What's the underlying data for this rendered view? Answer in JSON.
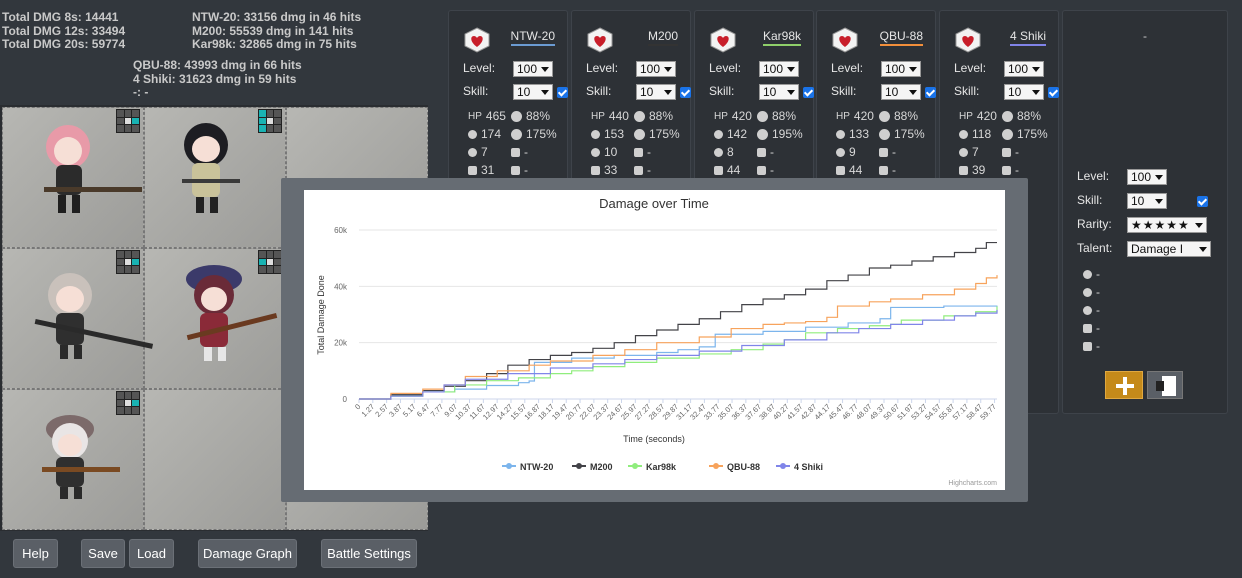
{
  "totals": [
    "Total DMG 8s: 14441",
    "Total DMG 12s: 33494",
    "Total DMG 20s: 59774"
  ],
  "dmg_lines_right": [
    "NTW-20: 33156 dmg in 46 hits",
    "M200: 55539 dmg in 141 hits",
    "Kar98k: 32865 dmg in 75 hits"
  ],
  "dmg_lines_lower": [
    "QBU-88: 43993 dmg in 66 hits",
    "4 Shiki: 31623 dmg in 59 hits",
    "-: -"
  ],
  "buttons": {
    "help": "Help",
    "save": "Save",
    "load": "Load",
    "graph": "Damage Graph",
    "battle": "Battle Settings"
  },
  "labels": {
    "level": "Level:",
    "skill": "Skill:",
    "rarity": "Rarity:",
    "talent": "Talent:"
  },
  "dolls": [
    {
      "name": "NTW-20",
      "color": "#6b9bd2",
      "level": "100",
      "skill": "10",
      "hp": "465",
      "acc": "88%",
      "fp": "174",
      "crit": "175%",
      "ev": "7",
      "ammo": "-",
      "armor": "31",
      "extra": "-"
    },
    {
      "name": "M200",
      "color": "#333333",
      "level": "100",
      "skill": "10",
      "hp": "440",
      "acc": "88%",
      "fp": "153",
      "crit": "175%",
      "ev": "10",
      "ammo": "-",
      "armor": "33",
      "extra": "-"
    },
    {
      "name": "Kar98k",
      "color": "#8fcf6a",
      "level": "100",
      "skill": "10",
      "hp": "420",
      "acc": "88%",
      "fp": "142",
      "crit": "195%",
      "ev": "8",
      "ammo": "-",
      "armor": "44",
      "extra": "-"
    },
    {
      "name": "QBU-88",
      "color": "#f28f3b",
      "level": "100",
      "skill": "10",
      "hp": "420",
      "acc": "88%",
      "fp": "133",
      "crit": "175%",
      "ev": "9",
      "ammo": "-",
      "armor": "44",
      "extra": "-"
    },
    {
      "name": "4 Shiki",
      "color": "#8083e8",
      "level": "100",
      "skill": "10",
      "hp": "420",
      "acc": "88%",
      "fp": "118",
      "crit": "175%",
      "ev": "7",
      "ammo": "-",
      "armor": "39",
      "extra": "-"
    }
  ],
  "empty_panel": {
    "title": "-",
    "level": "100",
    "skill": "10",
    "rarity": "★★★★★",
    "talent": "Damage I",
    "stats": [
      "-",
      "-",
      "-",
      "-",
      "-"
    ]
  },
  "colors": {
    "accent": "#c58a1a",
    "heart": "#c81e2a",
    "background": "#32373d",
    "teal": "#19b3b3"
  },
  "chart_data": {
    "type": "line",
    "title": "Damage over Time",
    "xlabel": "Time (seconds)",
    "ylabel": "Total Damage Done",
    "ylim": [
      0,
      60000
    ],
    "yticks": [
      "0",
      "20k",
      "40k",
      "60k"
    ],
    "xticks": [
      "0",
      "1.27",
      "2.57",
      "3.87",
      "5.17",
      "6.47",
      "7.77",
      "9.07",
      "10.37",
      "11.67",
      "12.97",
      "14.27",
      "15.57",
      "16.87",
      "18.17",
      "19.47",
      "20.77",
      "22.07",
      "23.37",
      "24.67",
      "25.97",
      "27.27",
      "28.57",
      "29.87",
      "31.17",
      "32.47",
      "33.77",
      "35.07",
      "36.37",
      "37.67",
      "38.97",
      "40.27",
      "41.57",
      "42.87",
      "44.17",
      "45.47",
      "46.77",
      "48.07",
      "49.37",
      "50.67",
      "51.97",
      "53.27",
      "54.57",
      "55.87",
      "57.17",
      "58.47",
      "59.77"
    ],
    "legend_position": "bottom",
    "credit": "Highcharts.com",
    "series": [
      {
        "name": "NTW-20",
        "color": "#7cb5ec",
        "points": [
          [
            0,
            0
          ],
          [
            3,
            1500
          ],
          [
            6,
            2500
          ],
          [
            9,
            3500
          ],
          [
            12,
            4800
          ],
          [
            15,
            5800
          ],
          [
            16,
            6400
          ],
          [
            16.5,
            13000
          ],
          [
            20,
            14500
          ],
          [
            24,
            15500
          ],
          [
            28,
            16500
          ],
          [
            30,
            17500
          ],
          [
            32,
            18500
          ],
          [
            33.5,
            23000
          ],
          [
            38,
            24000
          ],
          [
            42,
            25500
          ],
          [
            46,
            27000
          ],
          [
            49,
            28500
          ],
          [
            50,
            32500
          ],
          [
            55,
            33000
          ],
          [
            60,
            33156
          ]
        ]
      },
      {
        "name": "M200",
        "color": "#434348",
        "points": [
          [
            0,
            0
          ],
          [
            3,
            1500
          ],
          [
            6,
            3000
          ],
          [
            8,
            4500
          ],
          [
            10,
            6500
          ],
          [
            12,
            9000
          ],
          [
            14,
            12000
          ],
          [
            16,
            14000
          ],
          [
            18,
            15500
          ],
          [
            20,
            16500
          ],
          [
            22,
            18000
          ],
          [
            24,
            20000
          ],
          [
            26,
            22500
          ],
          [
            28,
            24500
          ],
          [
            30,
            26500
          ],
          [
            32,
            28500
          ],
          [
            34,
            31000
          ],
          [
            36,
            33500
          ],
          [
            38,
            35500
          ],
          [
            40,
            37000
          ],
          [
            42,
            39000
          ],
          [
            44,
            42000
          ],
          [
            46,
            44000
          ],
          [
            48,
            46500
          ],
          [
            50,
            47500
          ],
          [
            52,
            49000
          ],
          [
            54,
            50500
          ],
          [
            56,
            52000
          ],
          [
            58,
            53500
          ],
          [
            59,
            55539
          ],
          [
            60,
            55539
          ]
        ]
      },
      {
        "name": "Kar98k",
        "color": "#90ed7d",
        "points": [
          [
            0,
            0
          ],
          [
            3,
            1000
          ],
          [
            6,
            2500
          ],
          [
            9,
            5000
          ],
          [
            12,
            6500
          ],
          [
            15,
            7500
          ],
          [
            18,
            9000
          ],
          [
            20,
            10000
          ],
          [
            22,
            11500
          ],
          [
            25,
            13000
          ],
          [
            28,
            14500
          ],
          [
            32,
            16000
          ],
          [
            35,
            17500
          ],
          [
            38,
            19500
          ],
          [
            40,
            21000
          ],
          [
            42,
            23500
          ],
          [
            45,
            25000
          ],
          [
            48,
            26000
          ],
          [
            50,
            26500
          ],
          [
            51,
            28000
          ],
          [
            55,
            29500
          ],
          [
            58,
            31000
          ],
          [
            60,
            32865
          ]
        ]
      },
      {
        "name": "QBU-88",
        "color": "#f7a35c",
        "points": [
          [
            0,
            0
          ],
          [
            3,
            2000
          ],
          [
            6,
            3500
          ],
          [
            8,
            5000
          ],
          [
            10,
            8000
          ],
          [
            13,
            10000
          ],
          [
            16,
            12000
          ],
          [
            18,
            13500
          ],
          [
            22,
            15500
          ],
          [
            25,
            17500
          ],
          [
            28,
            20000
          ],
          [
            32,
            22000
          ],
          [
            35,
            25000
          ],
          [
            38,
            26500
          ],
          [
            40,
            27000
          ],
          [
            42,
            27500
          ],
          [
            44,
            29000
          ],
          [
            45,
            33000
          ],
          [
            48,
            34500
          ],
          [
            50,
            35500
          ],
          [
            53,
            37000
          ],
          [
            56,
            39000
          ],
          [
            58,
            41000
          ],
          [
            59,
            43000
          ],
          [
            60,
            43993
          ]
        ]
      },
      {
        "name": "4 Shiki",
        "color": "#8085e9",
        "points": [
          [
            0,
            0
          ],
          [
            3,
            1000
          ],
          [
            6,
            2500
          ],
          [
            8,
            5000
          ],
          [
            10,
            7000
          ],
          [
            14,
            9000
          ],
          [
            18,
            11000
          ],
          [
            22,
            12500
          ],
          [
            25,
            14000
          ],
          [
            28,
            15500
          ],
          [
            32,
            17000
          ],
          [
            36,
            19000
          ],
          [
            40,
            21000
          ],
          [
            44,
            23500
          ],
          [
            47,
            25000
          ],
          [
            50,
            26500
          ],
          [
            53,
            28000
          ],
          [
            56,
            29500
          ],
          [
            58,
            30500
          ],
          [
            60,
            31623
          ]
        ]
      }
    ]
  }
}
